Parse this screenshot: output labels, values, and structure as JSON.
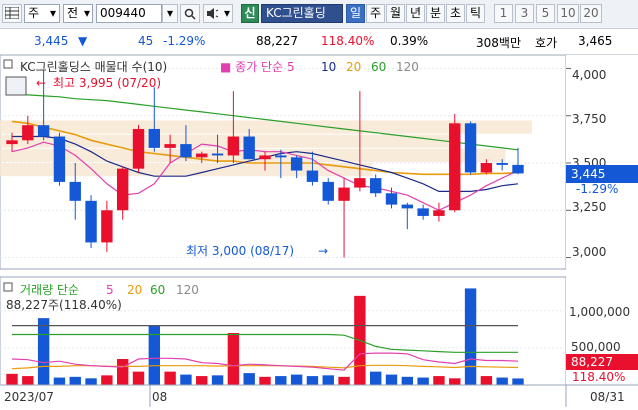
{
  "toolbar": {
    "menu_icon": "grid-menu-icon",
    "market": "주",
    "market_arrow": "▾",
    "code_type": "전",
    "code_type_arrow": "▾",
    "stock_code": "009440",
    "dropdown_arrow": "▾",
    "search_icon": "search-icon",
    "speaker_icon": "speaker-icon",
    "speaker_arrow": "▾",
    "credit_badge": "신",
    "stock_name": "KC그린홀딩",
    "periods": [
      "일",
      "주",
      "월",
      "년",
      "분",
      "초",
      "틱"
    ],
    "selected_period": "일",
    "intervals": [
      "1",
      "3",
      "5",
      "10",
      "20"
    ]
  },
  "quote": {
    "price": "3,445",
    "direction": "▼",
    "change": "45",
    "change_pct": "-1.29%",
    "volume": "88,227",
    "volume_ratio": "118.40%",
    "turnover": "0.39%",
    "amount": "308백만",
    "ask_label": "호가",
    "ask_price": "3,465"
  },
  "colors": {
    "up": "#e8102d",
    "down": "#1458d6",
    "ma5": "#e040b0",
    "ma10": "#1a2a8c",
    "ma20": "#e89b0c",
    "ma60": "#2aa02a",
    "ma120": "#8a8a8a"
  },
  "price_panel": {
    "title": "KC그린홀딩스 매물대 수(10)",
    "ma_title": "종가 단순",
    "ma_periods": [
      "5",
      "10",
      "20",
      "60",
      "120"
    ],
    "high_annotation": "최고 3,995 (07/20)",
    "low_annotation": "최저 3,000 (08/17)",
    "y_ticks": [
      "4,000",
      "3,750",
      "3,500",
      "3,250",
      "3,000"
    ],
    "current_price": "3,445",
    "current_change": "-1.29%"
  },
  "volume_panel": {
    "title": "거래량 단순",
    "ma_periods": [
      "5",
      "20",
      "60",
      "120"
    ],
    "info": "88,227주(118.40%)",
    "y_ticks": [
      "1,000,000",
      "500,000"
    ],
    "current_volume": "88,227",
    "current_ratio": "118.40%"
  },
  "x_axis": {
    "labels": [
      "2023/07",
      "08",
      "08/31"
    ]
  },
  "chart_data": [
    {
      "type": "candlestick",
      "title": "KC그린홀딩스 매물대 수(10)",
      "ylim": [
        2950,
        4050
      ],
      "candles": [
        {
          "o": 3600,
          "h": 3660,
          "l": 3560,
          "c": 3620
        },
        {
          "o": 3620,
          "h": 3750,
          "l": 3600,
          "c": 3700
        },
        {
          "o": 3700,
          "h": 3995,
          "l": 3620,
          "c": 3640
        },
        {
          "o": 3640,
          "h": 3660,
          "l": 3380,
          "c": 3400
        },
        {
          "o": 3400,
          "h": 3500,
          "l": 3200,
          "c": 3300
        },
        {
          "o": 3300,
          "h": 3330,
          "l": 3050,
          "c": 3080
        },
        {
          "o": 3080,
          "h": 3300,
          "l": 3030,
          "c": 3250
        },
        {
          "o": 3250,
          "h": 3480,
          "l": 3200,
          "c": 3470
        },
        {
          "o": 3470,
          "h": 3700,
          "l": 3450,
          "c": 3680
        },
        {
          "o": 3680,
          "h": 3900,
          "l": 3560,
          "c": 3580
        },
        {
          "o": 3580,
          "h": 3650,
          "l": 3500,
          "c": 3600
        },
        {
          "o": 3600,
          "h": 3700,
          "l": 3510,
          "c": 3530
        },
        {
          "o": 3530,
          "h": 3560,
          "l": 3500,
          "c": 3550
        },
        {
          "o": 3550,
          "h": 3650,
          "l": 3500,
          "c": 3540
        },
        {
          "o": 3540,
          "h": 3880,
          "l": 3500,
          "c": 3640
        },
        {
          "o": 3640,
          "h": 3680,
          "l": 3520,
          "c": 3520
        },
        {
          "o": 3520,
          "h": 3560,
          "l": 3460,
          "c": 3540
        },
        {
          "o": 3540,
          "h": 3570,
          "l": 3420,
          "c": 3530
        },
        {
          "o": 3530,
          "h": 3540,
          "l": 3420,
          "c": 3460
        },
        {
          "o": 3460,
          "h": 3560,
          "l": 3380,
          "c": 3400
        },
        {
          "o": 3400,
          "h": 3420,
          "l": 3280,
          "c": 3300
        },
        {
          "o": 3300,
          "h": 3420,
          "l": 3000,
          "c": 3370
        },
        {
          "o": 3370,
          "h": 3880,
          "l": 3350,
          "c": 3420
        },
        {
          "o": 3420,
          "h": 3440,
          "l": 3320,
          "c": 3340
        },
        {
          "o": 3340,
          "h": 3370,
          "l": 3260,
          "c": 3280
        },
        {
          "o": 3280,
          "h": 3290,
          "l": 3150,
          "c": 3260
        },
        {
          "o": 3260,
          "h": 3280,
          "l": 3200,
          "c": 3220
        },
        {
          "o": 3220,
          "h": 3290,
          "l": 3190,
          "c": 3250
        },
        {
          "o": 3250,
          "h": 3760,
          "l": 3240,
          "c": 3710
        },
        {
          "o": 3710,
          "h": 3720,
          "l": 3440,
          "c": 3450
        },
        {
          "o": 3450,
          "h": 3520,
          "l": 3440,
          "c": 3500
        },
        {
          "o": 3500,
          "h": 3520,
          "l": 3460,
          "c": 3490
        },
        {
          "o": 3490,
          "h": 3580,
          "l": 3440,
          "c": 3445
        }
      ],
      "ma5": [
        3560,
        3580,
        3610,
        3590,
        3540,
        3470,
        3390,
        3330,
        3340,
        3390,
        3500,
        3550,
        3600,
        3590,
        3560,
        3570,
        3560,
        3560,
        3540,
        3520,
        3460,
        3420,
        3380,
        3370,
        3350,
        3330,
        3290,
        3250,
        3290,
        3330,
        3380,
        3420,
        3460
      ],
      "ma10": [
        3640,
        3640,
        3640,
        3630,
        3600,
        3560,
        3510,
        3480,
        3450,
        3430,
        3430,
        3430,
        3450,
        3470,
        3490,
        3510,
        3530,
        3550,
        3560,
        3550,
        3530,
        3510,
        3490,
        3470,
        3450,
        3420,
        3390,
        3350,
        3350,
        3350,
        3360,
        3380,
        3390
      ],
      "ma20": [
        3720,
        3710,
        3690,
        3670,
        3650,
        3620,
        3600,
        3580,
        3560,
        3550,
        3540,
        3530,
        3520,
        3510,
        3510,
        3500,
        3500,
        3500,
        3500,
        3500,
        3490,
        3480,
        3470,
        3460,
        3450,
        3445,
        3440,
        3440,
        3440,
        3440,
        3445,
        3445,
        3450
      ],
      "ma60": [
        3860,
        3860,
        3855,
        3850,
        3840,
        3835,
        3830,
        3820,
        3810,
        3800,
        3790,
        3780,
        3770,
        3760,
        3750,
        3740,
        3730,
        3720,
        3710,
        3700,
        3690,
        3680,
        3670,
        3660,
        3650,
        3640,
        3630,
        3620,
        3610,
        3600,
        3590,
        3580,
        3570
      ],
      "high": {
        "value": 3995,
        "date": "07/20"
      },
      "low": {
        "value": 3000,
        "date": "08/17"
      },
      "volume_profile": [
        {
          "low": 3650,
          "high": 3725,
          "weight": 1.0
        },
        {
          "low": 3575,
          "high": 3650,
          "weight": 0.85
        },
        {
          "low": 3500,
          "high": 3575,
          "weight": 0.95
        },
        {
          "low": 3425,
          "high": 3500,
          "weight": 0.7
        }
      ]
    },
    {
      "type": "bar",
      "title": "거래량 단순",
      "ylim": [
        0,
        1400000
      ],
      "values": [
        150000,
        120000,
        900000,
        100000,
        110000,
        90000,
        130000,
        350000,
        180000,
        800000,
        180000,
        140000,
        120000,
        130000,
        700000,
        160000,
        110000,
        120000,
        140000,
        120000,
        130000,
        110000,
        1200000,
        180000,
        140000,
        110000,
        100000,
        120000,
        90000,
        1300000,
        120000,
        100000,
        88227
      ],
      "ma5": [
        350000,
        340000,
        300000,
        320000,
        280000,
        260000,
        250000,
        240000,
        350000,
        360000,
        360000,
        350000,
        300000,
        290000,
        260000,
        280000,
        270000,
        260000,
        250000,
        240000,
        220000,
        200000,
        420000,
        430000,
        430000,
        420000,
        340000,
        310000,
        290000,
        350000,
        330000,
        330000,
        320000
      ],
      "ma20": [
        220000,
        230000,
        250000,
        250000,
        260000,
        260000,
        250000,
        250000,
        250000,
        260000,
        260000,
        260000,
        260000,
        255000,
        260000,
        260000,
        260000,
        258000,
        255000,
        250000,
        240000,
        230000,
        260000,
        265000,
        265000,
        260000,
        250000,
        245000,
        235000,
        250000,
        245000,
        240000,
        235000
      ],
      "ma60": [
        680000,
        680000,
        680000,
        680000,
        680000,
        680000,
        680000,
        680000,
        680000,
        680000,
        680000,
        680000,
        680000,
        680000,
        680000,
        680000,
        680000,
        680000,
        680000,
        680000,
        680000,
        670000,
        600000,
        520000,
        480000,
        470000,
        460000,
        450000,
        440000,
        440000,
        440000,
        440000,
        440000
      ],
      "ma120": [
        800000,
        800000,
        800000,
        800000,
        800000,
        800000,
        800000,
        800000,
        800000,
        800000,
        800000,
        800000,
        800000,
        800000,
        800000,
        800000,
        800000,
        800000,
        800000,
        800000,
        800000,
        800000,
        800000,
        800000,
        800000,
        800000,
        800000,
        800000,
        800000,
        800000,
        800000,
        800000,
        800000
      ]
    }
  ]
}
